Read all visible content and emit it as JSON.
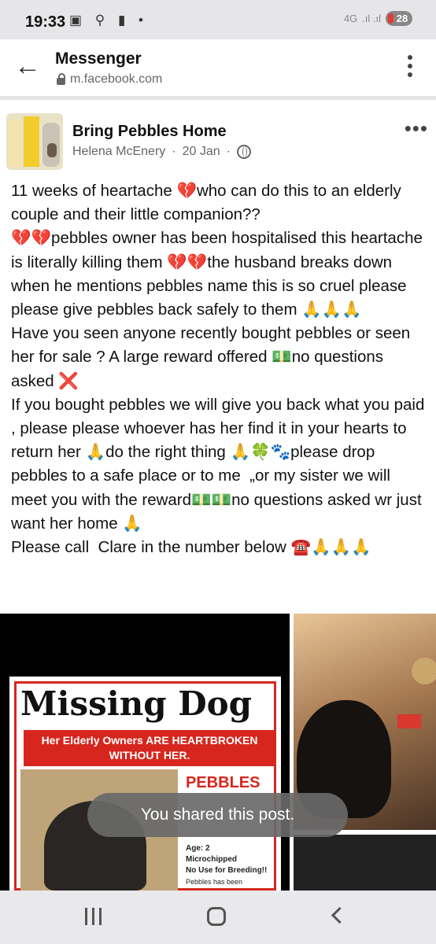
{
  "status_bar": {
    "time": "19:33",
    "icons": [
      "screenshot-icon",
      "usb-icon",
      "alert-icon",
      "dot-icon"
    ],
    "network": "4G",
    "battery": "28"
  },
  "app_bar": {
    "title": "Messenger",
    "url": "m.facebook.com"
  },
  "post": {
    "page_name": "Bring Pebbles Home",
    "author": "Helena McEnery",
    "separator": "·",
    "date": "20 Jan",
    "text": "11 weeks of heartache 💔who can do this to an elderly couple and their little companion??\n💔💔pebbles owner has been hospitalised this heartache is literally killing them 💔💔the husband breaks down when he mentions pebbles name this is so cruel please please give pebbles back safely to them 🙏🙏🙏\nHave you seen anyone recently bought pebbles or seen her for sale ? A large reward offered 💵no questions asked ❌\nIf you bought pebbles we will give you back what you paid , please please whoever has her find it in your hearts to return her 🙏do the right thing 🙏🍀🐾please drop  pebbles to a safe place or to me  „or my sister we will meet you with the reward💵💵no questions asked wr just want her home 🙏\nPlease call  Clare in the number below ☎️🙏🙏🙏"
  },
  "poster": {
    "heading": "Missing Dog",
    "banner_line1": "Her Elderly Owners ARE HEARTBROKEN",
    "banner_line2": "WITHOUT HER.",
    "dog_name": "PEBBLES",
    "age": "Age: 2",
    "microchipped": "Microchipped",
    "no_breeding": "No Use for Breeding!!",
    "since": "Pebbles has been"
  },
  "toast": "You shared this post."
}
